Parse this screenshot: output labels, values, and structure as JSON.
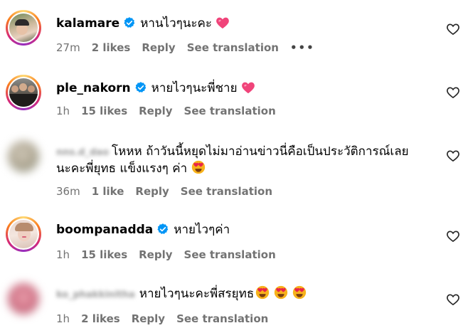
{
  "comments": [
    {
      "username": "kalamare",
      "verified": true,
      "text": "หานไวๆนะคะ",
      "emoji": "pink-heart",
      "emoji_count": 1,
      "time": "27m",
      "likes": "2 likes",
      "reply": "Reply",
      "translate": "See translation",
      "more": "•••"
    },
    {
      "username": "ple_nakorn",
      "verified": true,
      "text": "หายไวๆนะพี่ชาย",
      "emoji": "pink-heart",
      "emoji_count": 1,
      "time": "1h",
      "likes": "15 likes",
      "reply": "Reply",
      "translate": "See translation"
    },
    {
      "username": "nns.d_dao",
      "verified": false,
      "text": "โหหห ถ้าวันนี้หยุดไม่มาอ่านข่าวนี่คือเป็นประวัติการณ์เลย",
      "text_line2": "นะคะพี่ยุทธ แข็งแรงๆ ค่า",
      "emoji": "heart-eyes",
      "emoji_count": 1,
      "time": "36m",
      "likes": "1 like",
      "reply": "Reply",
      "translate": "See translation"
    },
    {
      "username": "boompanadda",
      "verified": true,
      "text": "หายไวๆค่า",
      "time": "1h",
      "likes": "15 likes",
      "reply": "Reply",
      "translate": "See translation"
    },
    {
      "username": "ko_phakkinitha",
      "verified": false,
      "text": "หายไวๆนะคะพี่สรยุทธ",
      "emoji": "heart-eyes",
      "emoji_count": 3,
      "time": "1h",
      "likes": "2 likes",
      "reply": "Reply",
      "translate": "See translation"
    }
  ],
  "colors": {
    "verified_blue": "#0095f6",
    "meta_gray": "#737373",
    "heart_pink": "#f0447a",
    "heart_eyes_face": "#f7b21b",
    "heart_eyes_red": "#e8234a"
  },
  "icons": {
    "like": "heart-outline-icon",
    "verified": "verified-badge-icon",
    "more": "more-options-icon"
  }
}
